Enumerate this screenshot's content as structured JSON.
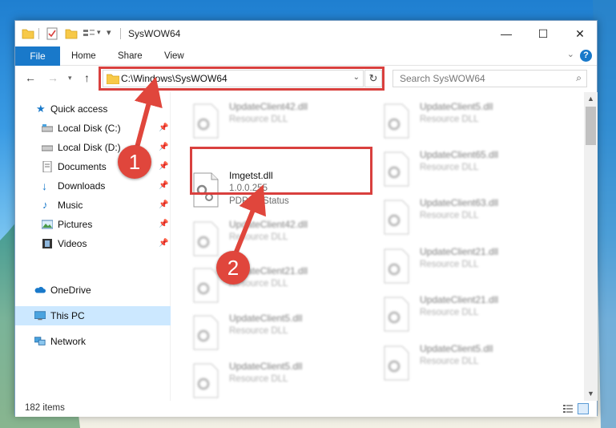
{
  "window": {
    "title": "SysWOW64",
    "controls": {
      "minimize": "—",
      "maximize": "☐",
      "close": "✕"
    }
  },
  "ribbon": {
    "file": "File",
    "tabs": [
      "Home",
      "Share",
      "View"
    ],
    "help": "?"
  },
  "address": {
    "path": "C:\\Windows\\SysWOW64",
    "search_placeholder": "Search SysWOW64"
  },
  "nav": {
    "items": [
      {
        "label": "Quick access",
        "icon": "star-icon",
        "pinned": false
      },
      {
        "label": "Local Disk (C:)",
        "icon": "drive-icon",
        "pinned": true
      },
      {
        "label": "Local Disk (D:)",
        "icon": "drive-icon",
        "pinned": true
      },
      {
        "label": "Documents",
        "icon": "documents-icon",
        "pinned": true
      },
      {
        "label": "Downloads",
        "icon": "download-arrow-icon",
        "pinned": true
      },
      {
        "label": "Music",
        "icon": "music-note-icon",
        "pinned": true
      },
      {
        "label": "Pictures",
        "icon": "pictures-icon",
        "pinned": true
      },
      {
        "label": "Videos",
        "icon": "videos-icon",
        "pinned": true
      },
      {
        "label": "OneDrive",
        "icon": "cloud-icon",
        "pinned": false
      },
      {
        "label": "This PC",
        "icon": "monitor-icon",
        "pinned": false,
        "selected": true
      },
      {
        "label": "Network",
        "icon": "network-icon",
        "pinned": false
      }
    ]
  },
  "files": {
    "col1": [
      {
        "name": "UpdateClient42.dll",
        "line1": "Resource DLL",
        "line2": ""
      },
      {
        "name": "Imgetst.dll",
        "line1": "1.0.0.255",
        "line2": "PDPGetStatus",
        "highlighted": true
      },
      {
        "name": "UpdateClient42.dll",
        "line1": "Resource DLL",
        "line2": ""
      },
      {
        "name": "UpdateClient21.dll",
        "line1": "Resource DLL",
        "line2": ""
      },
      {
        "name": "UpdateClient5.dll",
        "line1": "Resource DLL",
        "line2": ""
      },
      {
        "name": "UpdateClient5.dll",
        "line1": "Resource DLL",
        "line2": ""
      }
    ],
    "col2": [
      {
        "name": "UpdateClient5.dll",
        "line1": "Resource DLL"
      },
      {
        "name": "UpdateClient65.dll",
        "line1": "Resource DLL"
      },
      {
        "name": "UpdateClient63.dll",
        "line1": "Resource DLL"
      },
      {
        "name": "UpdateClient21.dll",
        "line1": "Resource DLL"
      },
      {
        "name": "UpdateClient21.dll",
        "line1": "Resource DLL"
      },
      {
        "name": "UpdateClient5.dll",
        "line1": "Resource DLL"
      }
    ]
  },
  "status": {
    "count": "182 items"
  },
  "callouts": [
    "1",
    "2"
  ],
  "colors": {
    "accent": "#1979ca",
    "callout": "#e0463c",
    "highlight_box": "#d9403e",
    "selected_nav": "#cce8ff"
  }
}
